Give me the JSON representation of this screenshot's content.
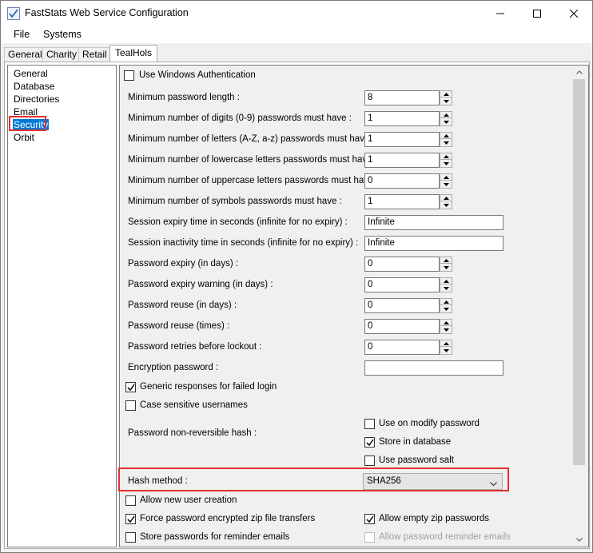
{
  "window": {
    "title": "FastStats Web Service Configuration"
  },
  "menu": {
    "file": "File",
    "systems": "Systems"
  },
  "tabs": [
    "General",
    "Charity",
    "Retail",
    "TealHols"
  ],
  "nav": {
    "items": [
      "General",
      "Database",
      "Directories",
      "Email",
      "Security",
      "Orbit"
    ],
    "selected": "Security"
  },
  "settings": {
    "use_windows_auth": {
      "label": "Use Windows Authentication",
      "checked": false
    },
    "fields": [
      {
        "label": "Minimum password length :",
        "value": "8"
      },
      {
        "label": "Minimum number of digits (0-9) passwords must have :",
        "value": "1"
      },
      {
        "label": "Minimum number of letters (A-Z, a-z) passwords must have :",
        "value": "1"
      },
      {
        "label": "Minimum number of lowercase letters passwords must have :",
        "value": "1"
      },
      {
        "label": "Minimum number of uppercase letters passwords must have :",
        "value": "0"
      },
      {
        "label": "Minimum number of symbols passwords must have :",
        "value": "1"
      },
      {
        "label": "Session expiry time in seconds (infinite for no expiry) :",
        "value": "Infinite"
      },
      {
        "label": "Session inactivity time in seconds (infinite for no expiry) :",
        "value": "Infinite"
      },
      {
        "label": "Password expiry (in days) :",
        "value": "0"
      },
      {
        "label": "Password expiry warning (in days) :",
        "value": "0"
      },
      {
        "label": "Password reuse (in days) :",
        "value": "0"
      },
      {
        "label": "Password reuse (times) :",
        "value": "0"
      },
      {
        "label": "Password retries before lockout :",
        "value": "0"
      },
      {
        "label": "Encryption password :",
        "value": ""
      }
    ],
    "generic_responses": {
      "label": "Generic responses for failed login",
      "checked": true
    },
    "case_sensitive": {
      "label": "Case sensitive usernames",
      "checked": false
    },
    "hash": {
      "label": "Password non-reversible hash :",
      "use_on_modify": {
        "label": "Use on modify password",
        "checked": false
      },
      "store_in_db": {
        "label": "Store in database",
        "checked": true
      },
      "use_salt": {
        "label": "Use password salt",
        "checked": false
      }
    },
    "hash_method": {
      "label": "Hash method :",
      "value": "SHA256"
    },
    "allow_new_user": {
      "label": "Allow new user creation",
      "checked": false
    },
    "force_encrypted_zip": {
      "label": "Force password encrypted zip file transfers",
      "checked": true
    },
    "allow_empty_zip": {
      "label": "Allow empty zip passwords",
      "checked": true
    },
    "store_reminder": {
      "label": "Store passwords for reminder emails",
      "checked": false
    },
    "allow_reminder": {
      "label": "Allow password reminder emails",
      "checked": false,
      "disabled": true
    }
  },
  "colors": {
    "selection": "#0078d7",
    "highlight": "#e0322f"
  }
}
